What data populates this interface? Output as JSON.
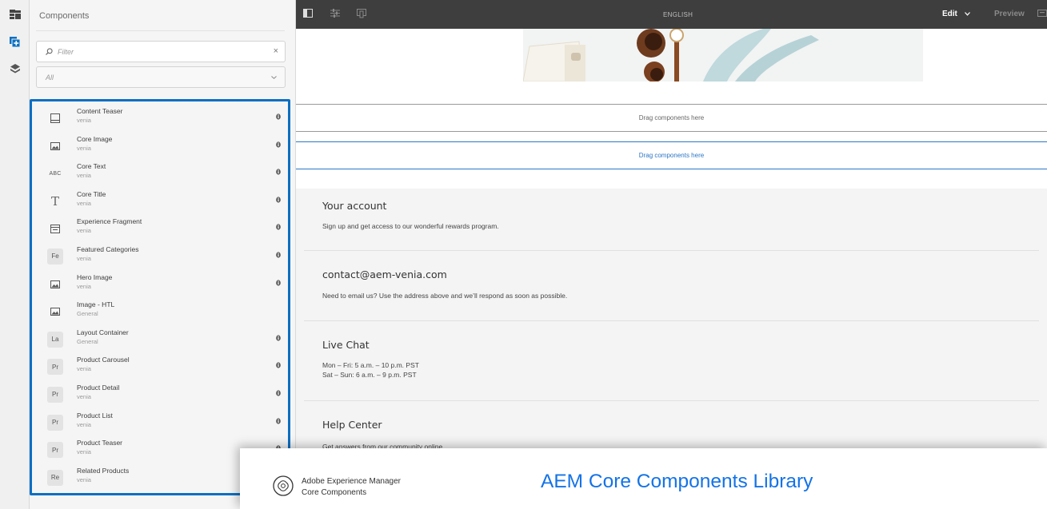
{
  "rail": {
    "items": [
      {
        "icon": "page-tree-icon"
      },
      {
        "icon": "components-icon"
      },
      {
        "icon": "layers-icon"
      }
    ]
  },
  "panel": {
    "title": "Components",
    "filter_placeholder": "Filter",
    "clear_symbol": "×",
    "group_value": "All",
    "components": [
      {
        "name": "Content Teaser",
        "group": "venia",
        "icon": "teaser-icon",
        "glyph": "",
        "info": true
      },
      {
        "name": "Core Image",
        "group": "venia",
        "icon": "image-icon",
        "glyph": "",
        "info": true
      },
      {
        "name": "Core Text",
        "group": "venia",
        "icon": "abc-text-icon",
        "glyph": "ABC",
        "info": true
      },
      {
        "name": "Core Title",
        "group": "venia",
        "icon": "title-T-icon",
        "glyph": "T",
        "info": true
      },
      {
        "name": "Experience Fragment",
        "group": "venia",
        "icon": "fragment-icon",
        "glyph": "",
        "info": true
      },
      {
        "name": "Featured Categories",
        "group": "venia",
        "icon": "fe-badge-icon",
        "glyph": "Fe",
        "info": true
      },
      {
        "name": "Hero Image",
        "group": "venia",
        "icon": "image-icon",
        "glyph": "",
        "info": true
      },
      {
        "name": "Image - HTL",
        "group": "General",
        "icon": "image-icon",
        "glyph": "",
        "info": false
      },
      {
        "name": "Layout Container",
        "group": "General",
        "icon": "la-badge-icon",
        "glyph": "La",
        "info": true
      },
      {
        "name": "Product Carousel",
        "group": "venia",
        "icon": "pr-badge-icon",
        "glyph": "Pr",
        "info": true
      },
      {
        "name": "Product Detail",
        "group": "venia",
        "icon": "pr-badge-icon",
        "glyph": "Pr",
        "info": true
      },
      {
        "name": "Product List",
        "group": "venia",
        "icon": "pr-badge-icon",
        "glyph": "Pr",
        "info": true
      },
      {
        "name": "Product Teaser",
        "group": "venia",
        "icon": "pr-badge-icon",
        "glyph": "Pr",
        "info": true
      },
      {
        "name": "Related Products",
        "group": "venia",
        "icon": "re-badge-icon",
        "glyph": "Re",
        "info": false
      }
    ]
  },
  "toolbar": {
    "language": "ENGLISH",
    "edit_label": "Edit",
    "preview_label": "Preview"
  },
  "canvas": {
    "drop_zone_1": "Drag components here",
    "drop_zone_2": "Drag components here",
    "footer": [
      {
        "title": "Your account",
        "lines": [
          "Sign up and get access to our wonderful rewards program."
        ]
      },
      {
        "title": "contact@aem-venia.com",
        "lines": [
          "Need to email us? Use the address above and we’ll respond as soon as possible."
        ]
      },
      {
        "title": "Live Chat",
        "lines": [
          "Mon – Fri: 5 a.m. – 10 p.m. PST",
          "Sat – Sun: 6 a.m. – 9 p.m. PST"
        ]
      },
      {
        "title": "Help Center",
        "lines": [
          "Get answers from our community online"
        ]
      }
    ]
  },
  "banner": {
    "brand_line1": "Adobe Experience Manager",
    "brand_line2": "Core Components",
    "library_title": "AEM Core Components Library"
  },
  "colors": {
    "accent": "#0a6fc2",
    "toolbar_bg": "#3e3e3e",
    "banner_title": "#1473e6"
  }
}
